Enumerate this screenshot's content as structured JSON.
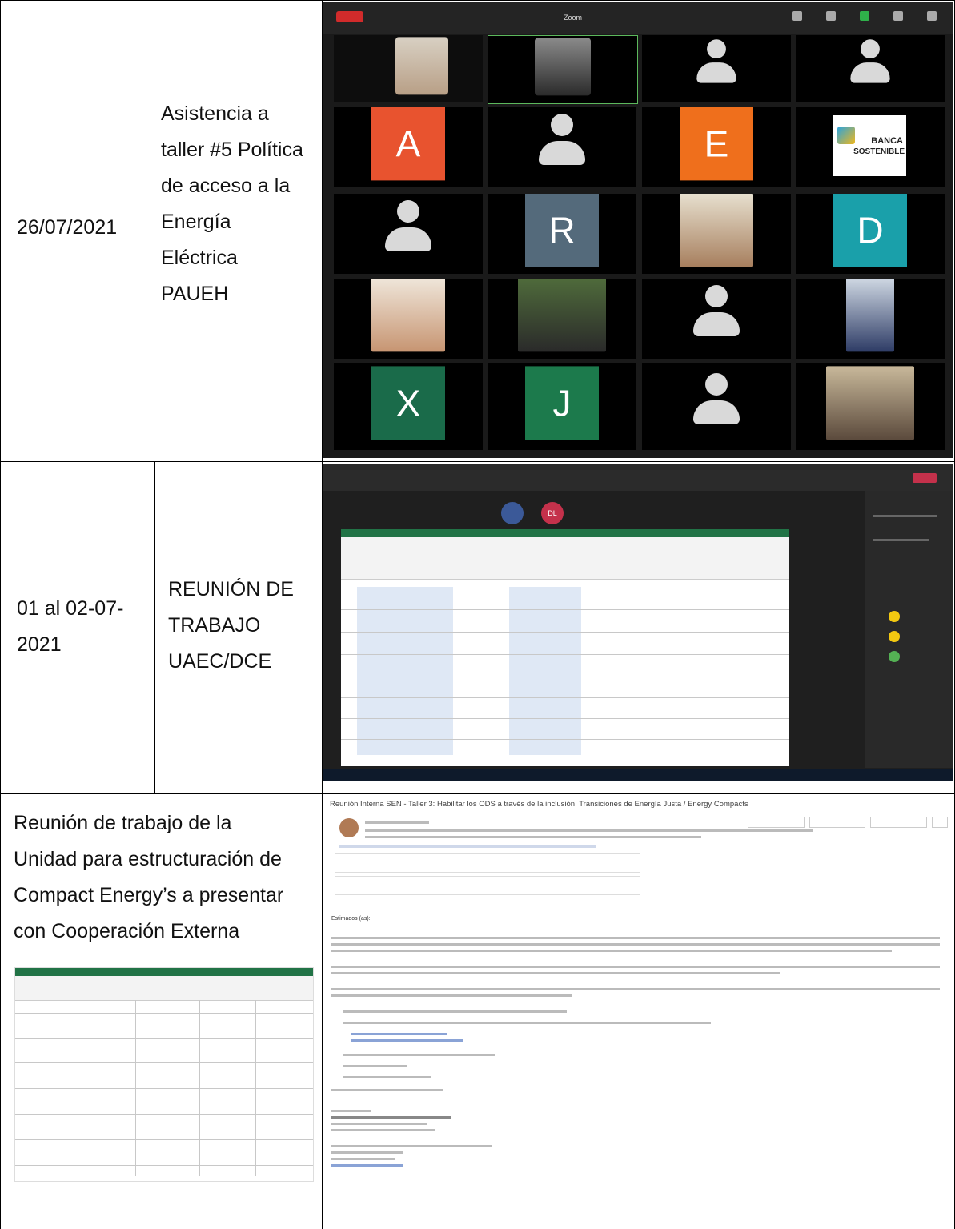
{
  "rows": [
    {
      "date": "26/07/2021",
      "activity_lines": [
        "Asistencia a",
        "taller #5 Política",
        "de acceso a la",
        "Energía",
        "Eléctrica",
        "PAUEH"
      ],
      "screenshot": {
        "type": "video-call-gallery",
        "app_title": "Zoom",
        "participant_initials": [
          "A",
          "E",
          "R",
          "D",
          "X",
          "J"
        ],
        "logo_text": [
          "BANCA",
          "SOSTENIBLE"
        ],
        "colors": {
          "A": "#e8532f",
          "E": "#ef6f1c",
          "R": "#546a7b",
          "D": "#1aa0aa",
          "X": "#1a6b4a",
          "J": "#1c7a4c"
        }
      }
    },
    {
      "date_lines": [
        "01 al 02-07-",
        "2021"
      ],
      "activity_lines": [
        "REUNIÓN DE",
        "TRABAJO",
        "UAEC/DCE"
      ],
      "screenshot": {
        "type": "meeting-with-shared-spreadsheet",
        "participant_badge": "DL"
      }
    },
    {
      "activity_lines": [
        "Reunión de trabajo de la",
        "Unidad para estructuración de",
        "Compact Energy’s a presentar",
        "con Cooperación Externa"
      ],
      "screenshot": {
        "type": "email",
        "subject": "Reunión Interna SEN - Taller 3: Habilitar los ODS a través de la inclusión, Transiciones de Energía Justa / Energy Compacts",
        "greeting": "Estimados (as):"
      }
    }
  ]
}
